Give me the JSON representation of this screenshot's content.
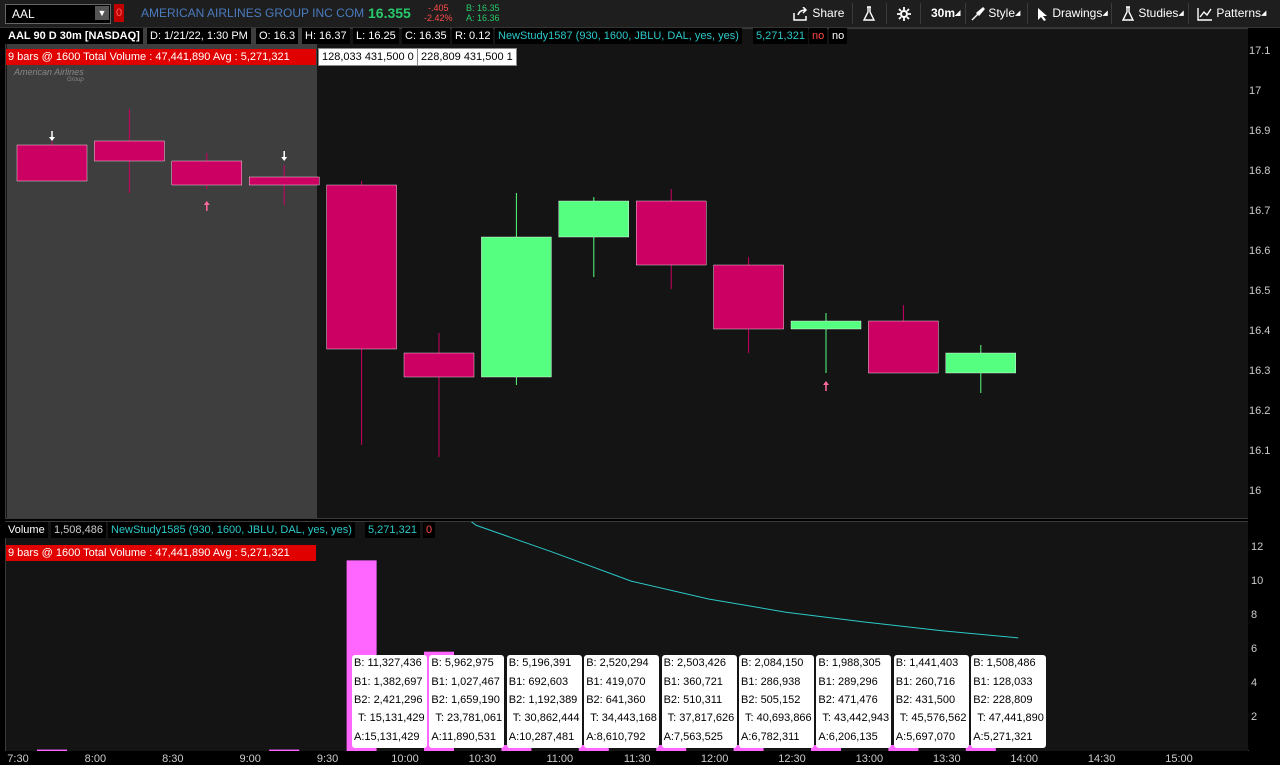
{
  "topbar": {
    "symbol": "AAL",
    "alert_badge": "0",
    "company": "AMERICAN AIRLINES GROUP INC COM",
    "last": "16.355",
    "change": "-.405",
    "change_pct": "-2.42%",
    "bid": "B: 16.35",
    "ask": "A: 16.36",
    "share_label": "Share",
    "timeframe": "30m",
    "style_label": "Style",
    "drawings_label": "Drawings",
    "studies_label": "Studies",
    "patterns_label": "Patterns"
  },
  "price_panel": {
    "title": "AAL 90 D 30m [NASDAQ]",
    "date": "D: 1/21/22, 1:30 PM",
    "open": "O: 16.3",
    "high": "H: 16.37",
    "low": "L: 16.25",
    "close": "C: 16.35",
    "range": "R: 0.12",
    "study": "NewStudy1587 (930, 1600, JBLU, DAL, yes, yes)",
    "study_value": "5,271,321",
    "flag1": "no",
    "flag2": "no",
    "bars_note": "9 bars @ 1600 Total Volume : 47,441,890  Avg : 5,271,321",
    "box1": "128,033 431,500 0",
    "box2": "228,809 431,500 1",
    "watermark": "American Airlines",
    "watermark_sub": "Group",
    "yticks": [
      "17.1",
      "17",
      "16.9",
      "16.8",
      "16.7",
      "16.6",
      "16.5",
      "16.4",
      "16.3",
      "16.2",
      "16.1",
      "16"
    ]
  },
  "volume_panel": {
    "title": "Volume",
    "value": "1,508,486",
    "study": "NewStudy1585 (930, 1600, JBLU, DAL, yes, yes)",
    "study_value": "5,271,321",
    "flag": "0",
    "bars_note": "9 bars @ 1600 Total Volume : 47,441,890  Avg : 5,271,321",
    "yticks": [
      "12",
      "10",
      "8",
      "6",
      "4",
      "2"
    ]
  },
  "xaxis": [
    "7:30",
    "8:00",
    "8:30",
    "9:00",
    "9:30",
    "10:00",
    "10:30",
    "11:00",
    "11:30",
    "12:00",
    "12:30",
    "13:00",
    "13:30",
    "14:00",
    "14:30",
    "15:00"
  ],
  "tooltips": [
    {
      "b": "B: 11,327,436",
      "b1": "B1: 1,382,697",
      "b2": "B2: 2,421,296",
      "t": "T: 15,131,429",
      "a": "A:15,131,429"
    },
    {
      "b": "B: 5,962,975",
      "b1": "B1: 1,027,467",
      "b2": "B2: 1,659,190",
      "t": "T: 23,781,061",
      "a": "A:11,890,531"
    },
    {
      "b": "B: 5,196,391",
      "b1": "B1: 692,603",
      "b2": "B2: 1,192,389",
      "t": "T: 30,862,444",
      "a": "A:10,287,481"
    },
    {
      "b": "B: 2,520,294",
      "b1": "B1: 419,070",
      "b2": "B2: 641,360",
      "t": "T: 34,443,168",
      "a": "A:8,610,792"
    },
    {
      "b": "B: 2,503,426",
      "b1": "B1: 360,721",
      "b2": "B2: 510,311",
      "t": "T: 37,817,626",
      "a": "A:7,563,525"
    },
    {
      "b": "B: 2,084,150",
      "b1": "B1: 286,938",
      "b2": "B2: 505,152",
      "t": "T: 40,693,866",
      "a": "A:6,782,311"
    },
    {
      "b": "B: 1,988,305",
      "b1": "B1: 289,296",
      "b2": "B2: 471,476",
      "t": "T: 43,442,943",
      "a": "A:6,206,135"
    },
    {
      "b": "B: 1,441,403",
      "b1": "B1: 260,716",
      "b2": "B2: 431,500",
      "t": "T: 45,576,562",
      "a": "A:5,697,070"
    },
    {
      "b": "B: 1,508,486",
      "b1": "B1: 128,033",
      "b2": "B2: 228,809",
      "t": "T: 47,441,890",
      "a": "A:5,271,321"
    }
  ],
  "colors": {
    "up": "#55ff7f",
    "down": "#cc0062",
    "volume": "#ff66ff",
    "study_line": "#2cc9c9"
  },
  "chart_data": {
    "type": "candlestick",
    "price_range": [
      16.0,
      17.1
    ],
    "candles": [
      {
        "time": "7:30",
        "o": 16.87,
        "h": 16.88,
        "l": 16.78,
        "c": 16.78
      },
      {
        "time": "8:00",
        "o": 16.88,
        "h": 16.96,
        "l": 16.75,
        "c": 16.83
      },
      {
        "time": "8:30",
        "o": 16.83,
        "h": 16.85,
        "l": 16.76,
        "c": 16.77
      },
      {
        "time": "9:00",
        "o": 16.79,
        "h": 16.82,
        "l": 16.72,
        "c": 16.77
      },
      {
        "time": "9:30",
        "o": 16.77,
        "h": 16.78,
        "l": 16.12,
        "c": 16.36
      },
      {
        "time": "10:00",
        "o": 16.35,
        "h": 16.4,
        "l": 16.09,
        "c": 16.29
      },
      {
        "time": "10:30",
        "o": 16.29,
        "h": 16.75,
        "l": 16.27,
        "c": 16.64
      },
      {
        "time": "11:00",
        "o": 16.64,
        "h": 16.74,
        "l": 16.54,
        "c": 16.73
      },
      {
        "time": "11:30",
        "o": 16.73,
        "h": 16.76,
        "l": 16.51,
        "c": 16.57
      },
      {
        "time": "12:00",
        "o": 16.57,
        "h": 16.59,
        "l": 16.35,
        "c": 16.41
      },
      {
        "time": "12:30",
        "o": 16.41,
        "h": 16.45,
        "l": 16.3,
        "c": 16.43
      },
      {
        "time": "13:00",
        "o": 16.43,
        "h": 16.47,
        "l": 16.3,
        "c": 16.3
      },
      {
        "time": "13:30",
        "o": 16.3,
        "h": 16.37,
        "l": 16.25,
        "c": 16.35
      }
    ],
    "volume_range": [
      0,
      13
    ],
    "volume_unit": "M",
    "volumes": [
      0.2,
      0,
      0,
      0.2,
      11.33,
      5.96,
      0,
      0,
      0,
      0,
      0,
      0,
      0
    ],
    "study_line": [
      15.13,
      11.89,
      10.29,
      8.61,
      7.56,
      6.78,
      6.21,
      5.7,
      5.27
    ]
  }
}
